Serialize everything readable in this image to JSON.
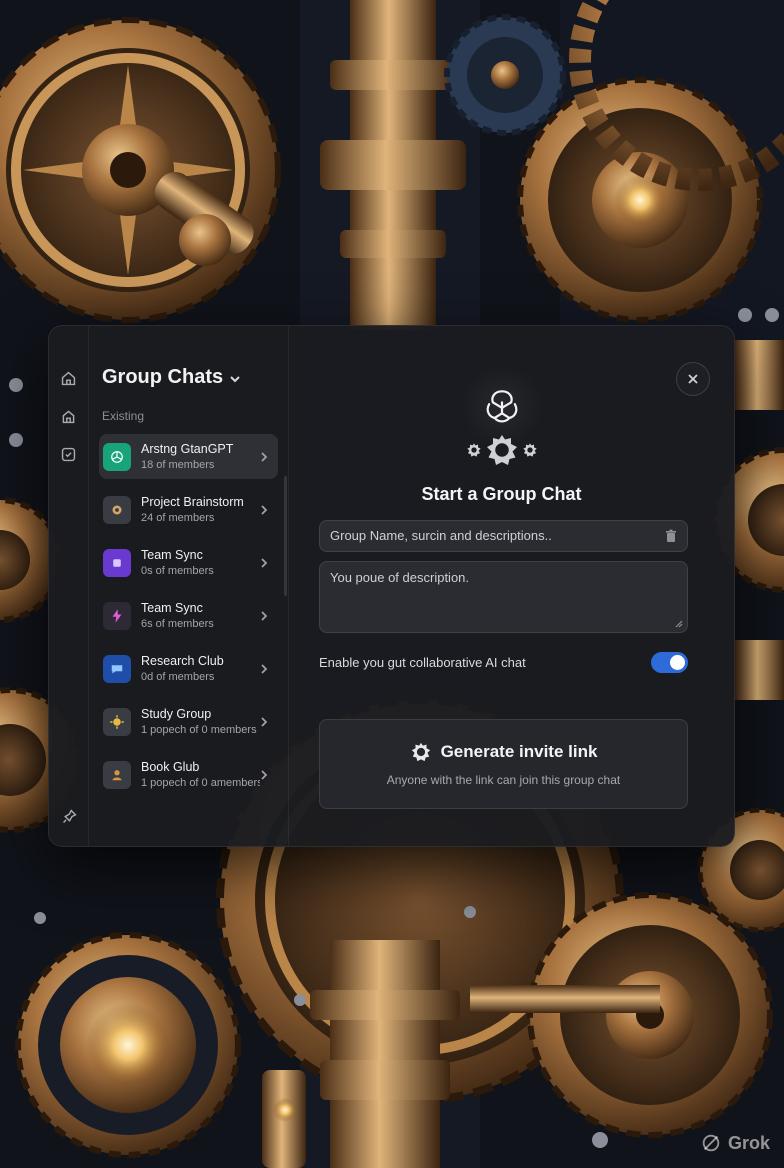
{
  "dialog": {
    "list": {
      "title": "Group Chats",
      "section_label": "Existing",
      "items": [
        {
          "name": "Arstng GtanGPT",
          "sub": "18 of members",
          "color": "#19a37a"
        },
        {
          "name": "Project Brainstorm",
          "sub": "24 of members",
          "color": "#3a3c44"
        },
        {
          "name": "Team Sync",
          "sub": "0s of members",
          "color": "#6a3ad0"
        },
        {
          "name": "Team Sync",
          "sub": "6s of members",
          "color": "#2d2a35"
        },
        {
          "name": "Research Club",
          "sub": "0d of members",
          "color": "#1f4ea8"
        },
        {
          "name": "Study Group",
          "sub": "1 popech of 0 members",
          "color": "#3a3c44"
        },
        {
          "name": "Book Glub",
          "sub": "1 popech of 0 amembers",
          "color": "#3a3c44"
        }
      ]
    },
    "main": {
      "heading": "Start a Group Chat",
      "name_placeholder": "Group Name, surcin and descriptions..",
      "desc_placeholder": "You poue of description.",
      "toggle_label": "Enable you gut collaborative AI chat",
      "toggle_on": true,
      "invite_title": "Generate invite link",
      "invite_sub": "Anyone with the link can join this group chat"
    }
  },
  "watermark": "Grok",
  "colors": {
    "accent": "#2f6ad9",
    "panel": "#1b1c20",
    "brass": "#b8864e"
  }
}
